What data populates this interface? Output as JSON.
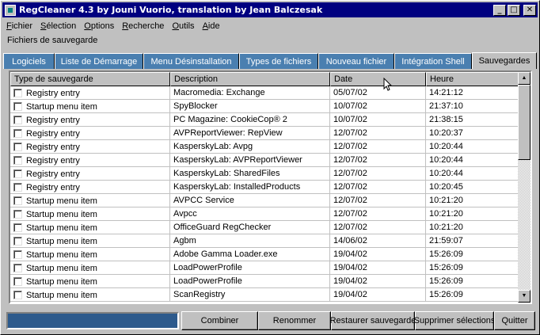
{
  "window": {
    "title": "RegCleaner 4.3 by Jouni Vuorio, translation by Jean Balczesak",
    "minimize_glyph": "_",
    "maximize_glyph": "□",
    "close_glyph": "✕"
  },
  "menu": [
    {
      "label": "Fichier",
      "mnemonic": "F",
      "rest": "ichier"
    },
    {
      "label": "Sélection",
      "mnemonic": "S",
      "rest": "élection"
    },
    {
      "label": "Options",
      "mnemonic": "O",
      "rest": "ptions"
    },
    {
      "label": "Recherche",
      "mnemonic": "R",
      "rest": "echerche"
    },
    {
      "label": "Outils",
      "mnemonic": "O",
      "rest": "utils"
    },
    {
      "label": "Aide",
      "mnemonic": "A",
      "rest": "ide"
    }
  ],
  "section_title": "Fichiers de sauvegarde",
  "tabs": [
    {
      "label": "Logiciels"
    },
    {
      "label": "Liste de Démarrage"
    },
    {
      "label": "Menu Désinstallation"
    },
    {
      "label": "Types de fichiers"
    },
    {
      "label": "Nouveau fichier"
    },
    {
      "label": "Intégration Shell"
    },
    {
      "label": "Sauvegardes",
      "active": true
    }
  ],
  "table": {
    "columns": [
      "Type de sauvegarde",
      "Description",
      "Date",
      "Heure"
    ],
    "rows": [
      [
        "Registry entry",
        "Macromedia: Exchange",
        "05/07/02",
        "14:21:12"
      ],
      [
        "Startup menu item",
        "SpyBlocker",
        "10/07/02",
        "21:37:10"
      ],
      [
        "Registry entry",
        "PC Magazine: CookieCop® 2",
        "10/07/02",
        "21:38:15"
      ],
      [
        "Registry entry",
        "AVPReportViewer: RepView",
        "12/07/02",
        "10:20:37"
      ],
      [
        "Registry entry",
        "KasperskyLab: Avpg",
        "12/07/02",
        "10:20:44"
      ],
      [
        "Registry entry",
        "KasperskyLab: AVPReportViewer",
        "12/07/02",
        "10:20:44"
      ],
      [
        "Registry entry",
        "KasperskyLab: SharedFiles",
        "12/07/02",
        "10:20:44"
      ],
      [
        "Registry entry",
        "KasperskyLab: InstalledProducts",
        "12/07/02",
        "10:20:45"
      ],
      [
        "Startup menu item",
        "AVPCC Service",
        "12/07/02",
        "10:21:20"
      ],
      [
        "Startup menu item",
        "Avpcc",
        "12/07/02",
        "10:21:20"
      ],
      [
        "Startup menu item",
        "OfficeGuard RegChecker",
        "12/07/02",
        "10:21:20"
      ],
      [
        "Startup menu item",
        "Agbm",
        "14/06/02",
        "21:59:07"
      ],
      [
        "Startup menu item",
        "Adobe Gamma Loader.exe",
        "19/04/02",
        "15:26:09"
      ],
      [
        "Startup menu item",
        "LoadPowerProfile",
        "19/04/02",
        "15:26:09"
      ],
      [
        "Startup menu item",
        "LoadPowerProfile",
        "19/04/02",
        "15:26:09"
      ],
      [
        "Startup menu item",
        "ScanRegistry",
        "19/04/02",
        "15:26:09"
      ]
    ]
  },
  "buttons": {
    "combine": "Combiner",
    "rename": "Renommer",
    "restore": "Restaurer sauvegarde",
    "delete": "Supprimer sélections",
    "quit": "Quitter"
  },
  "colors": {
    "titlebar": "#000080",
    "tab_inactive": "#4a7fb0",
    "progress": "#2d5a8c",
    "face": "#c0c0c0"
  }
}
